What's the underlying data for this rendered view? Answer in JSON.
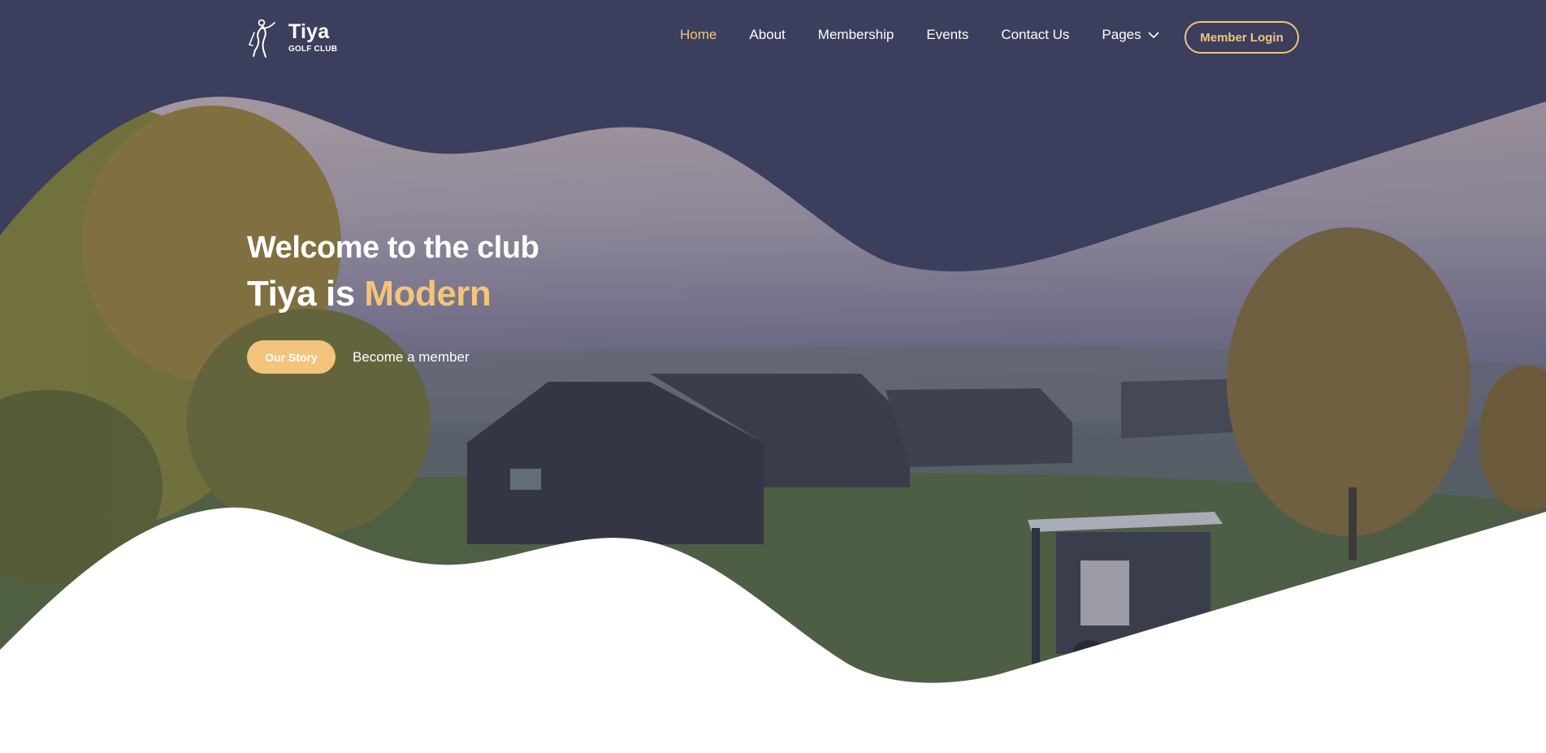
{
  "brand": {
    "name": "Tiya",
    "tagline": "GOLF CLUB",
    "logo_icon": "golfer-icon"
  },
  "nav": {
    "items": [
      {
        "label": "Home",
        "active": true
      },
      {
        "label": "About",
        "active": false
      },
      {
        "label": "Membership",
        "active": false
      },
      {
        "label": "Events",
        "active": false
      },
      {
        "label": "Contact Us",
        "active": false
      },
      {
        "label": "Pages",
        "active": false,
        "icon": "chevron-down-icon"
      }
    ],
    "login_label": "Member Login"
  },
  "hero": {
    "line1": "Welcome to the club",
    "line2_prefix": "Tiya is",
    "line2_accent": "Modern",
    "primary_cta": "Our Story",
    "secondary_cta": "Become a member",
    "image": "golf-clubhouse-landscape-photo"
  },
  "colors": {
    "navy": "#3b3e5c",
    "accent": "#f3c47c",
    "white": "#ffffff"
  }
}
